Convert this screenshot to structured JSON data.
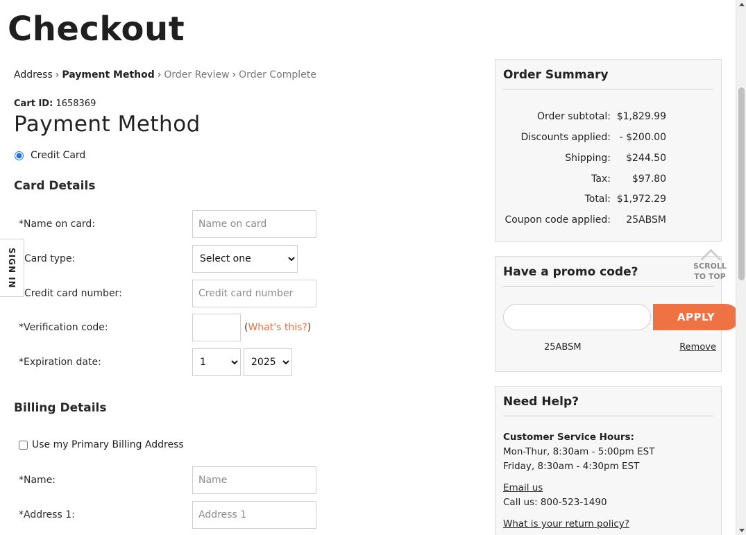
{
  "page": {
    "title": "Checkout"
  },
  "breadcrumb": {
    "items": [
      "Address",
      "Payment Method",
      "Order Review",
      "Order Complete"
    ],
    "separator": "›"
  },
  "cart": {
    "label": "Cart ID:",
    "id": "1658369"
  },
  "payment": {
    "title": "Payment Method",
    "option_label": "Credit Card",
    "option_selected": true
  },
  "card_details": {
    "title": "Card Details",
    "name_label": "*Name on card:",
    "name_placeholder": "Name on card",
    "type_label": "Card type:",
    "type_selected": "Select one",
    "number_label": "Credit card number:",
    "number_placeholder": "Credit card number",
    "cvv_label": "*Verification code:",
    "whats_this": "What's this?",
    "whats_this_open": "(",
    "whats_this_close": ")",
    "exp_label": "*Expiration date:",
    "exp_month": "1",
    "exp_year": "2025"
  },
  "billing": {
    "title": "Billing Details",
    "use_primary_label": "Use my Primary Billing Address",
    "use_primary_checked": false,
    "name_label": "*Name:",
    "name_placeholder": "Name",
    "address1_label": "*Address 1:",
    "address1_placeholder": "Address 1"
  },
  "signin_tab": {
    "label": "SIGN IN"
  },
  "order_summary": {
    "title": "Order Summary",
    "rows": [
      {
        "label": "Order subtotal:",
        "value": "$1,829.99"
      },
      {
        "label": "Discounts applied:",
        "value": "- $200.00"
      },
      {
        "label": "Shipping:",
        "value": "$244.50"
      },
      {
        "label": "Tax:",
        "value": "$97.80"
      },
      {
        "label": "Total:",
        "value": "$1,972.29"
      },
      {
        "label": "Coupon code applied:",
        "value": "25ABSM"
      }
    ]
  },
  "promo": {
    "title": "Have a promo code?",
    "input_value": "",
    "apply_label": "APPLY",
    "applied_code": "25ABSM",
    "remove_label": "Remove"
  },
  "help": {
    "title": "Need Help?",
    "hours_title": "Customer Service Hours:",
    "hours_line1": "Mon-Thur, 8:30am - 5:00pm EST",
    "hours_line2": "Friday, 8:30am - 4:30pm EST",
    "email_link": "Email us",
    "call": "Call us: 800-523-1490",
    "return_policy_link": "What is your return policy?"
  },
  "scroll_top": {
    "line1": "SCROLL",
    "line2": "TO TOP"
  },
  "colors": {
    "accent": "#ef7245",
    "radio": "#1a73e8",
    "box_bg": "#f7f7f7"
  }
}
